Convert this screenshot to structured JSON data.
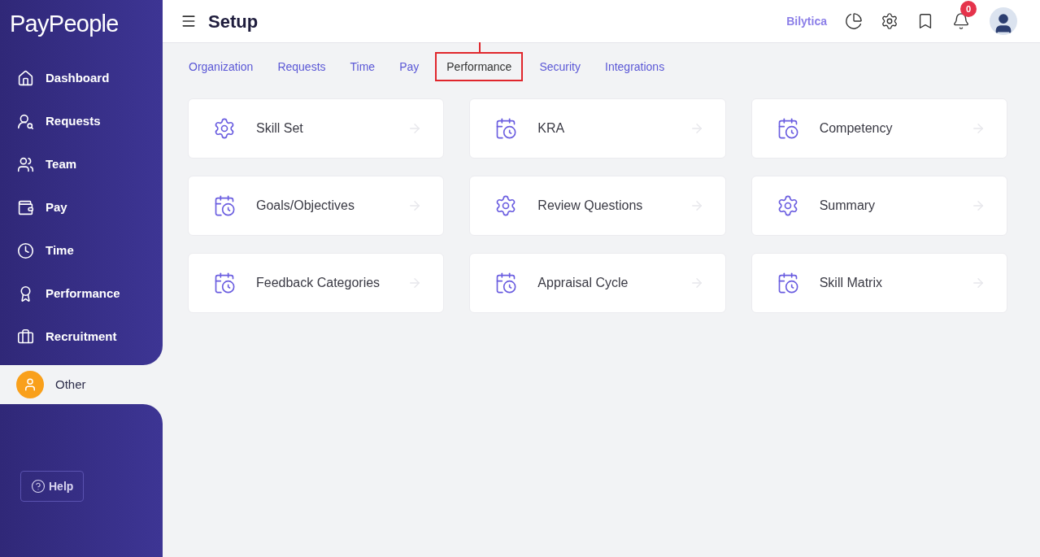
{
  "logo": "PayPeople",
  "sidebar": {
    "items": [
      {
        "label": "Dashboard",
        "selected": false
      },
      {
        "label": "Requests",
        "selected": false
      },
      {
        "label": "Team",
        "selected": false
      },
      {
        "label": "Pay",
        "selected": false
      },
      {
        "label": "Time",
        "selected": false
      },
      {
        "label": "Performance",
        "selected": false
      },
      {
        "label": "Recruitment",
        "selected": false
      },
      {
        "label": "Other",
        "selected": true
      }
    ],
    "help": "Help"
  },
  "header": {
    "title": "Setup",
    "company": "Bilytica",
    "notifications": "0"
  },
  "tabs": [
    {
      "label": "Organization",
      "selected": false
    },
    {
      "label": "Requests",
      "selected": false
    },
    {
      "label": "Time",
      "selected": false
    },
    {
      "label": "Pay",
      "selected": false
    },
    {
      "label": "Performance",
      "selected": true
    },
    {
      "label": "Security",
      "selected": false
    },
    {
      "label": "Integrations",
      "selected": false
    }
  ],
  "cards": [
    {
      "label": "Skill Set",
      "kind": "settings"
    },
    {
      "label": "KRA",
      "kind": "schedule"
    },
    {
      "label": "Competency",
      "kind": "schedule"
    },
    {
      "label": "Goals/Objectives",
      "kind": "schedule"
    },
    {
      "label": "Review Questions",
      "kind": "settings"
    },
    {
      "label": "Summary",
      "kind": "settings"
    },
    {
      "label": "Feedback Categories",
      "kind": "schedule"
    },
    {
      "label": "Appraisal Cycle",
      "kind": "schedule"
    },
    {
      "label": "Skill Matrix",
      "kind": "schedule"
    }
  ]
}
